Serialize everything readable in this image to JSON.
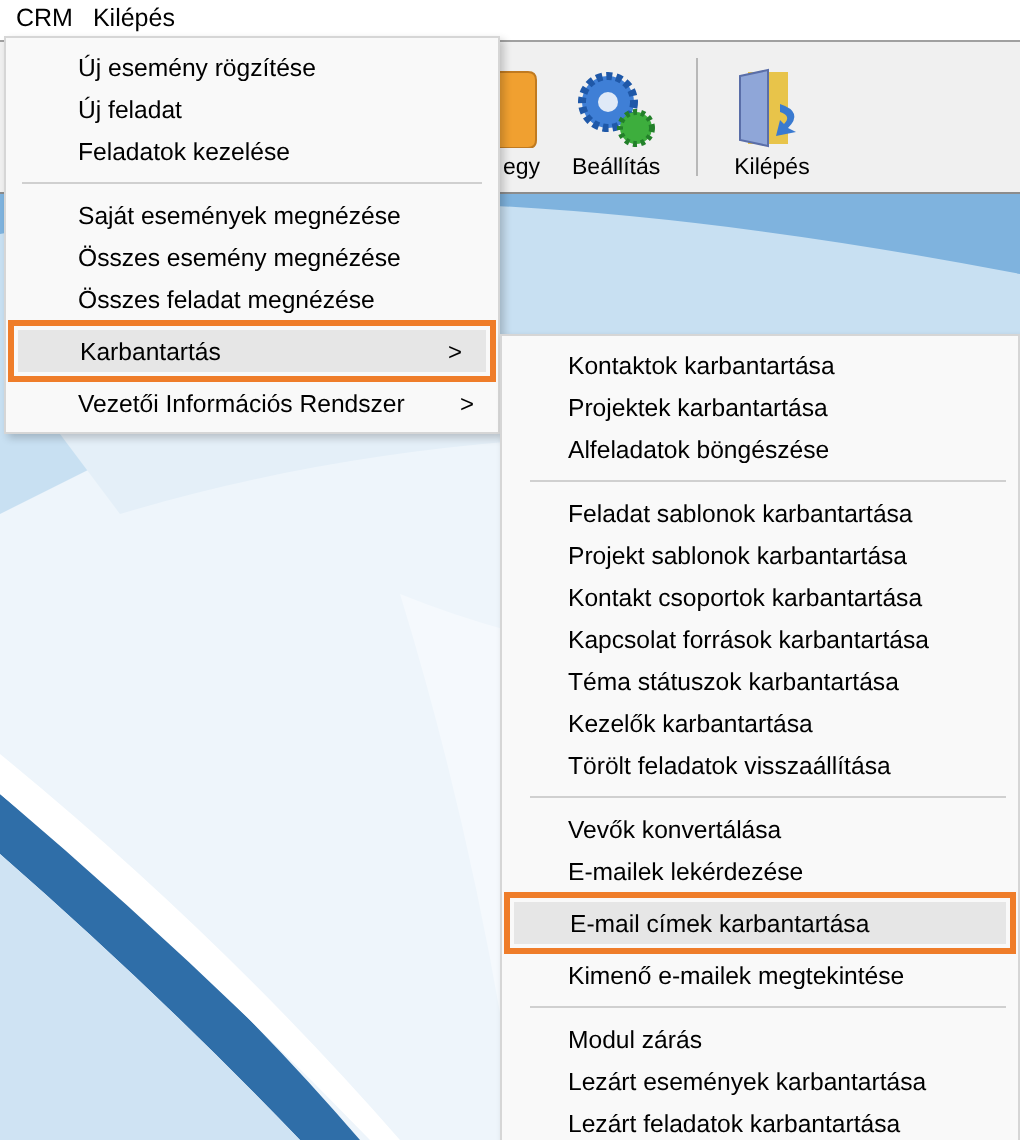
{
  "menubar": [
    {
      "label": "CRM"
    },
    {
      "label": "Kilépés"
    }
  ],
  "toolbar": [
    {
      "label": "egy",
      "kind": "partial"
    },
    {
      "label": "Beállítás",
      "kind": "settings"
    },
    {
      "kind": "separator"
    },
    {
      "label": "Kilépés",
      "kind": "exit"
    }
  ],
  "menu": {
    "items": [
      {
        "kind": "item",
        "label": "Új esemény rögzítése",
        "selected": false
      },
      {
        "kind": "item",
        "label": "Új feladat",
        "selected": false
      },
      {
        "kind": "item",
        "label": "Feladatok kezelése",
        "selected": false
      },
      {
        "kind": "separator"
      },
      {
        "kind": "item",
        "label": "Saját események megnézése",
        "selected": false
      },
      {
        "kind": "item",
        "label": "Összes esemény megnézése",
        "selected": false
      },
      {
        "kind": "item",
        "label": "Összes feladat megnézése",
        "selected": false
      },
      {
        "kind": "submenu",
        "label": "Karbantartás",
        "arrow": ">",
        "selected": true
      },
      {
        "kind": "submenu",
        "label": "Vezetői Információs Rendszer",
        "arrow": ">",
        "selected": false
      }
    ]
  },
  "submenu": {
    "items": [
      {
        "kind": "item",
        "label": "Kontaktok karbantartása",
        "selected": false
      },
      {
        "kind": "item",
        "label": "Projektek karbantartása",
        "selected": false
      },
      {
        "kind": "item",
        "label": "Alfeladatok böngészése",
        "selected": false
      },
      {
        "kind": "separator"
      },
      {
        "kind": "item",
        "label": "Feladat sablonok karbantartása",
        "selected": false
      },
      {
        "kind": "item",
        "label": "Projekt sablonok karbantartása",
        "selected": false
      },
      {
        "kind": "item",
        "label": "Kontakt csoportok karbantartása",
        "selected": false
      },
      {
        "kind": "item",
        "label": "Kapcsolat források karbantartása",
        "selected": false
      },
      {
        "kind": "item",
        "label": "Téma státuszok karbantartása",
        "selected": false
      },
      {
        "kind": "item",
        "label": "Kezelők karbantartása",
        "selected": false
      },
      {
        "kind": "item",
        "label": "Törölt feladatok visszaállítása",
        "selected": false
      },
      {
        "kind": "separator"
      },
      {
        "kind": "item",
        "label": "Vevők konvertálása",
        "selected": false
      },
      {
        "kind": "item",
        "label": "E-mailek lekérdezése",
        "selected": false
      },
      {
        "kind": "item",
        "label": "E-mail címek karbantartása",
        "selected": true
      },
      {
        "kind": "item",
        "label": "Kimenő e-mailek megtekintése",
        "selected": false
      },
      {
        "kind": "separator"
      },
      {
        "kind": "item",
        "label": "Modul zárás",
        "selected": false
      },
      {
        "kind": "item",
        "label": "Lezárt események karbantartása",
        "selected": false
      },
      {
        "kind": "item",
        "label": "Lezárt feladatok karbantartása",
        "selected": false
      }
    ]
  }
}
